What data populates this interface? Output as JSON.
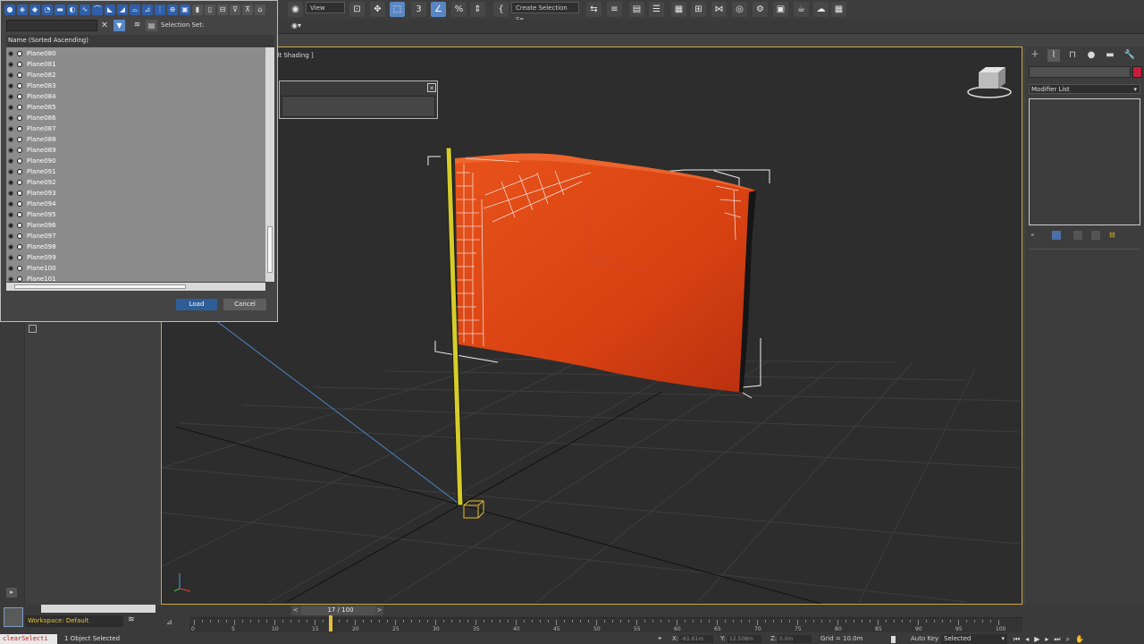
{
  "toolbar": {
    "view_dropdown": "View",
    "selection_set_dropdown": "Create Selection Se",
    "icons": [
      "undo-icon",
      "redo-icon",
      "link-icon",
      "unlink-icon",
      "bind-icon",
      "select-icon",
      "select-name-icon",
      "region-icon",
      "window-crossing-icon",
      "move-icon",
      "rotate-icon",
      "scale-icon",
      "snap-icon",
      "angle-snap-icon",
      "percent-snap-icon",
      "spinner-snap-icon",
      "mirror-icon",
      "align-icon",
      "layer-icon",
      "curve-editor-icon",
      "schematic-icon",
      "material-icon",
      "render-setup-icon",
      "render-frame-icon",
      "render-icon"
    ],
    "snap_label": "3"
  },
  "viewport": {
    "label": "ult Shading ]",
    "accent_color": "#c8a84c"
  },
  "dialog": {
    "selection_set_label": "Selection Set:",
    "column_header": "Name (Sorted Ascending)",
    "rows": [
      "Plane080",
      "Plane081",
      "Plane082",
      "Plane083",
      "Plane084",
      "Plane085",
      "Plane086",
      "Plane087",
      "Plane088",
      "Plane089",
      "Plane090",
      "Plane091",
      "Plane092",
      "Plane093",
      "Plane094",
      "Plane095",
      "Plane096",
      "Plane097",
      "Plane098",
      "Plane099",
      "Plane100",
      "Plane101"
    ],
    "load_label": "Load",
    "cancel_label": "Cancel"
  },
  "command_panel": {
    "modifier_list_label": "Modifier List",
    "color_swatch": "#c41e3a"
  },
  "bottom": {
    "workspace_label": "Workspace: Default",
    "time_slider_label": "17 / 100",
    "timeline_ticks": [
      "0",
      "5",
      "10",
      "15",
      "20",
      "25",
      "30",
      "35",
      "40",
      "45",
      "50",
      "55",
      "60",
      "65",
      "70",
      "75",
      "80",
      "85",
      "90",
      "95",
      "100"
    ],
    "current_frame": 17,
    "total_frames": 100,
    "maxscript_text": "clearSelecti",
    "status_text": "1 Object Selected",
    "x_label": "X:",
    "y_label": "Y:",
    "z_label": "Z:",
    "x_value": "-61.61m",
    "y_value": "12.508m",
    "z_value": "0.0m",
    "grid_label": "Grid = 10.0m",
    "autokey_label": "Auto Key",
    "selected_dropdown": "Selected"
  }
}
